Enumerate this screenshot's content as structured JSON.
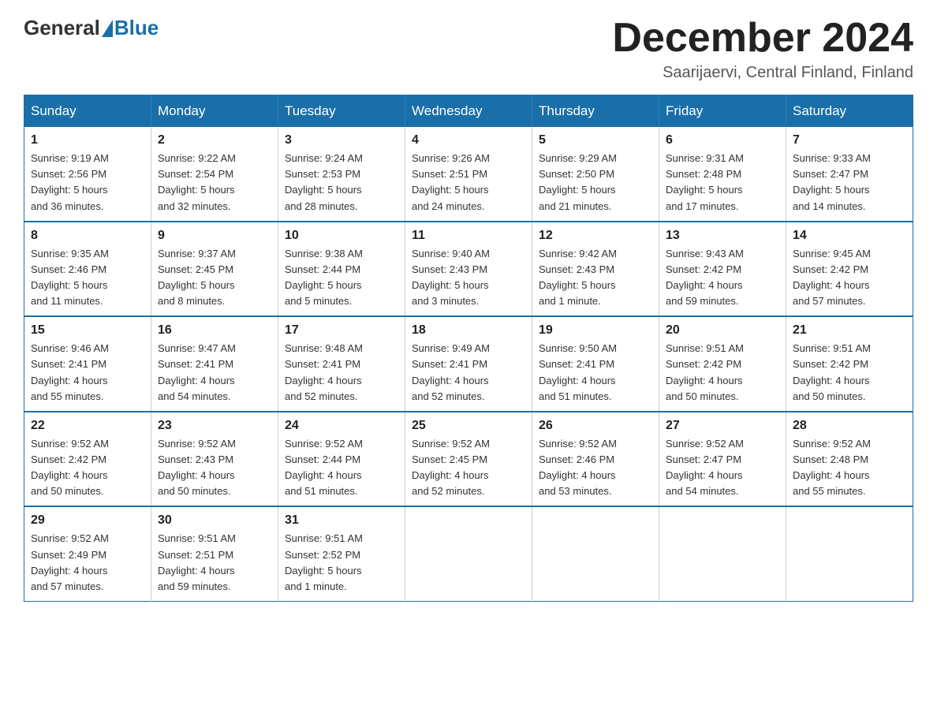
{
  "header": {
    "logo": {
      "general": "General",
      "blue": "Blue"
    },
    "title": "December 2024",
    "location": "Saarijaervi, Central Finland, Finland"
  },
  "days_of_week": [
    "Sunday",
    "Monday",
    "Tuesday",
    "Wednesday",
    "Thursday",
    "Friday",
    "Saturday"
  ],
  "weeks": [
    [
      {
        "day": "1",
        "sunrise": "9:19 AM",
        "sunset": "2:56 PM",
        "daylight": "5 hours and 36 minutes."
      },
      {
        "day": "2",
        "sunrise": "9:22 AM",
        "sunset": "2:54 PM",
        "daylight": "5 hours and 32 minutes."
      },
      {
        "day": "3",
        "sunrise": "9:24 AM",
        "sunset": "2:53 PM",
        "daylight": "5 hours and 28 minutes."
      },
      {
        "day": "4",
        "sunrise": "9:26 AM",
        "sunset": "2:51 PM",
        "daylight": "5 hours and 24 minutes."
      },
      {
        "day": "5",
        "sunrise": "9:29 AM",
        "sunset": "2:50 PM",
        "daylight": "5 hours and 21 minutes."
      },
      {
        "day": "6",
        "sunrise": "9:31 AM",
        "sunset": "2:48 PM",
        "daylight": "5 hours and 17 minutes."
      },
      {
        "day": "7",
        "sunrise": "9:33 AM",
        "sunset": "2:47 PM",
        "daylight": "5 hours and 14 minutes."
      }
    ],
    [
      {
        "day": "8",
        "sunrise": "9:35 AM",
        "sunset": "2:46 PM",
        "daylight": "5 hours and 11 minutes."
      },
      {
        "day": "9",
        "sunrise": "9:37 AM",
        "sunset": "2:45 PM",
        "daylight": "5 hours and 8 minutes."
      },
      {
        "day": "10",
        "sunrise": "9:38 AM",
        "sunset": "2:44 PM",
        "daylight": "5 hours and 5 minutes."
      },
      {
        "day": "11",
        "sunrise": "9:40 AM",
        "sunset": "2:43 PM",
        "daylight": "5 hours and 3 minutes."
      },
      {
        "day": "12",
        "sunrise": "9:42 AM",
        "sunset": "2:43 PM",
        "daylight": "5 hours and 1 minute."
      },
      {
        "day": "13",
        "sunrise": "9:43 AM",
        "sunset": "2:42 PM",
        "daylight": "4 hours and 59 minutes."
      },
      {
        "day": "14",
        "sunrise": "9:45 AM",
        "sunset": "2:42 PM",
        "daylight": "4 hours and 57 minutes."
      }
    ],
    [
      {
        "day": "15",
        "sunrise": "9:46 AM",
        "sunset": "2:41 PM",
        "daylight": "4 hours and 55 minutes."
      },
      {
        "day": "16",
        "sunrise": "9:47 AM",
        "sunset": "2:41 PM",
        "daylight": "4 hours and 54 minutes."
      },
      {
        "day": "17",
        "sunrise": "9:48 AM",
        "sunset": "2:41 PM",
        "daylight": "4 hours and 52 minutes."
      },
      {
        "day": "18",
        "sunrise": "9:49 AM",
        "sunset": "2:41 PM",
        "daylight": "4 hours and 52 minutes."
      },
      {
        "day": "19",
        "sunrise": "9:50 AM",
        "sunset": "2:41 PM",
        "daylight": "4 hours and 51 minutes."
      },
      {
        "day": "20",
        "sunrise": "9:51 AM",
        "sunset": "2:42 PM",
        "daylight": "4 hours and 50 minutes."
      },
      {
        "day": "21",
        "sunrise": "9:51 AM",
        "sunset": "2:42 PM",
        "daylight": "4 hours and 50 minutes."
      }
    ],
    [
      {
        "day": "22",
        "sunrise": "9:52 AM",
        "sunset": "2:42 PM",
        "daylight": "4 hours and 50 minutes."
      },
      {
        "day": "23",
        "sunrise": "9:52 AM",
        "sunset": "2:43 PM",
        "daylight": "4 hours and 50 minutes."
      },
      {
        "day": "24",
        "sunrise": "9:52 AM",
        "sunset": "2:44 PM",
        "daylight": "4 hours and 51 minutes."
      },
      {
        "day": "25",
        "sunrise": "9:52 AM",
        "sunset": "2:45 PM",
        "daylight": "4 hours and 52 minutes."
      },
      {
        "day": "26",
        "sunrise": "9:52 AM",
        "sunset": "2:46 PM",
        "daylight": "4 hours and 53 minutes."
      },
      {
        "day": "27",
        "sunrise": "9:52 AM",
        "sunset": "2:47 PM",
        "daylight": "4 hours and 54 minutes."
      },
      {
        "day": "28",
        "sunrise": "9:52 AM",
        "sunset": "2:48 PM",
        "daylight": "4 hours and 55 minutes."
      }
    ],
    [
      {
        "day": "29",
        "sunrise": "9:52 AM",
        "sunset": "2:49 PM",
        "daylight": "4 hours and 57 minutes."
      },
      {
        "day": "30",
        "sunrise": "9:51 AM",
        "sunset": "2:51 PM",
        "daylight": "4 hours and 59 minutes."
      },
      {
        "day": "31",
        "sunrise": "9:51 AM",
        "sunset": "2:52 PM",
        "daylight": "5 hours and 1 minute."
      },
      null,
      null,
      null,
      null
    ]
  ],
  "labels": {
    "sunrise": "Sunrise:",
    "sunset": "Sunset:",
    "daylight": "Daylight:"
  }
}
